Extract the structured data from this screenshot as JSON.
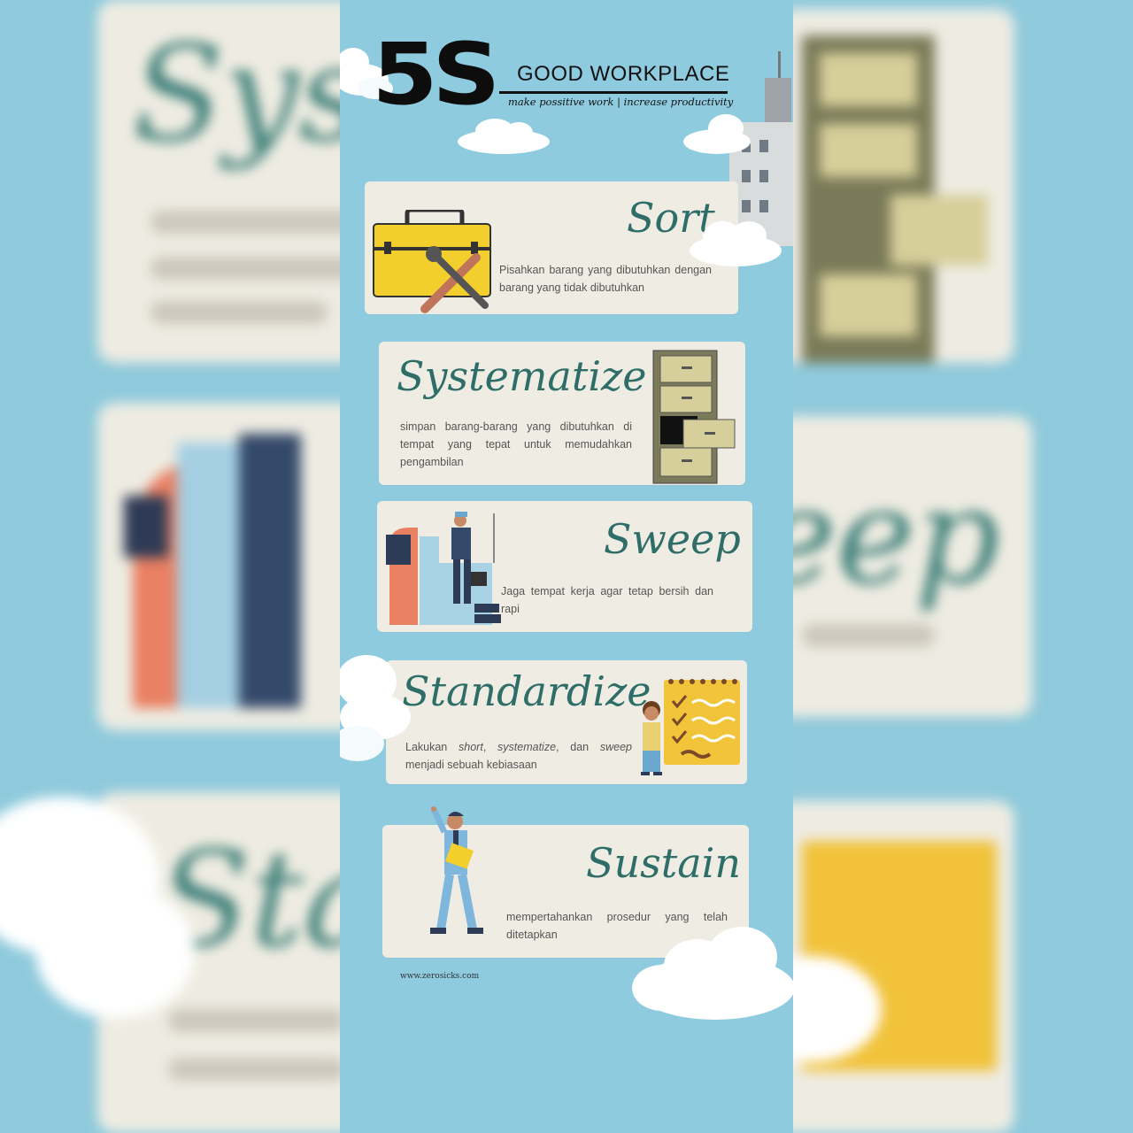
{
  "header": {
    "title": "5S",
    "subtitle": "GOOD WORKPLACE",
    "tagline": "make possitive work | increase productivity"
  },
  "cards": [
    {
      "title": "Sort",
      "desc": "Pisahkan barang yang dibutuhkan dengan barang yang tidak dibutuhkan",
      "icon": "toolbox-icon"
    },
    {
      "title": "Systematize",
      "desc": "simpan barang-barang yang dibutuhkan di tempat yang tepat untuk memudahkan pengambilan",
      "icon": "filing-cabinet-icon"
    },
    {
      "title": "Sweep",
      "desc": "Jaga tempat kerja agar tetap bersih dan rapi",
      "icon": "worker-icon"
    },
    {
      "title": "Standardize",
      "desc_pre": "Lakukan ",
      "desc_i1": "short",
      "desc_mid1": ", ",
      "desc_i2": "systematize",
      "desc_mid2": ", dan ",
      "desc_i3": "sweep",
      "desc_post": " menjadi sebuah kebiasaan",
      "icon": "checklist-icon"
    },
    {
      "title": "Sustain",
      "desc": "mempertahankan prosedur yang telah ditetapkan",
      "icon": "businessman-icon"
    }
  ],
  "footer": "www.zerosicks.com",
  "colors": {
    "background": "#8fcbdf",
    "card": "#efede3",
    "title_teal": "#2f6e68",
    "toolbox_yellow": "#f2cf2c"
  }
}
